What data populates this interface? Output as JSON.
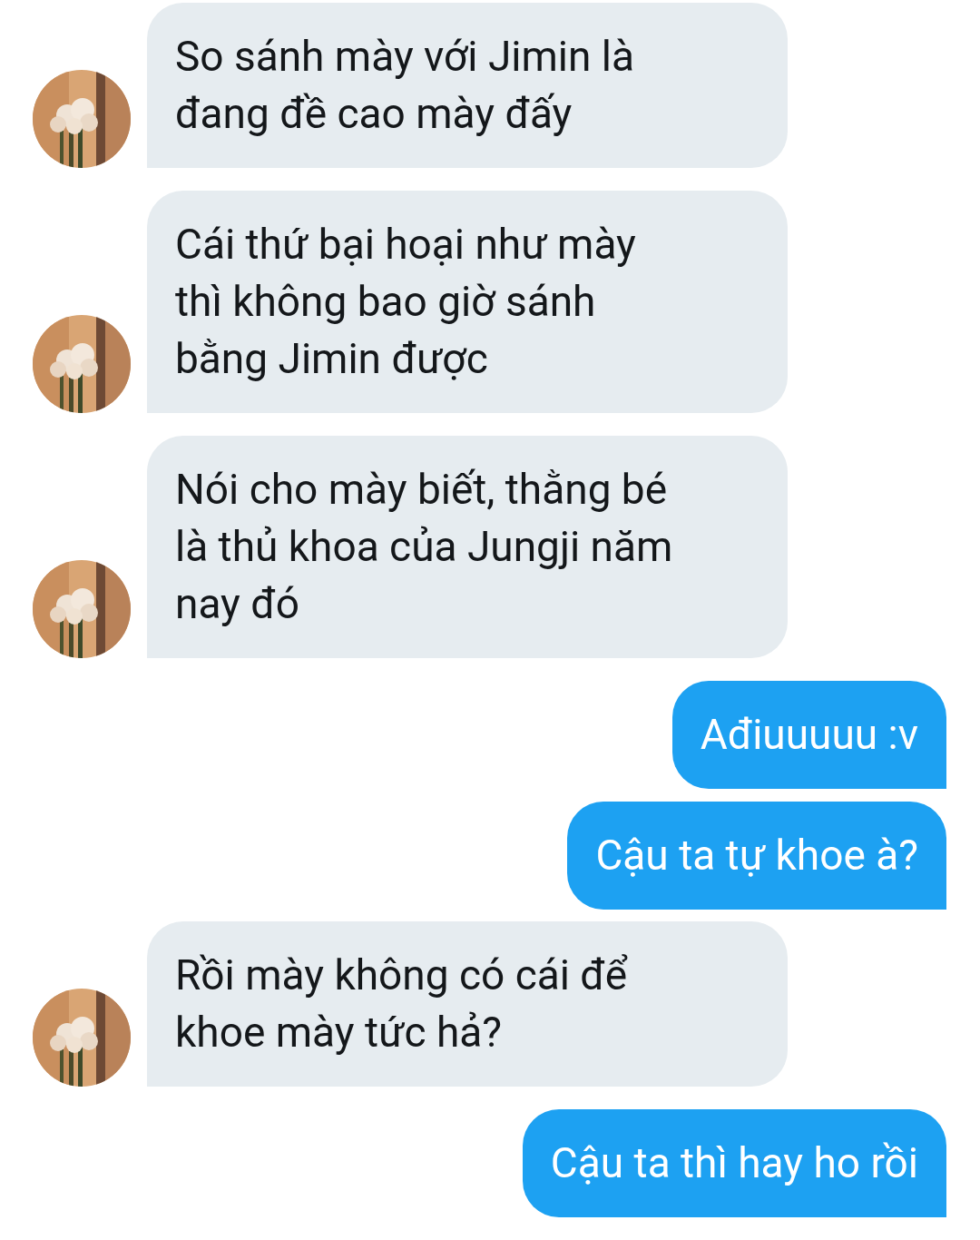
{
  "messages": [
    {
      "kind": "incoming",
      "text": "So sánh mày với Jimin là\nđang đề cao mày đấy"
    },
    {
      "kind": "incoming",
      "text": "Cái thứ bại hoại như mày\nthì không bao giờ sánh\nbằng Jimin được"
    },
    {
      "kind": "incoming",
      "text": "Nói cho mày biết, thằng bé\nlà thủ khoa của Jungji năm\nnay đó"
    },
    {
      "kind": "outgoing",
      "text": "Ađiuuuuu :v"
    },
    {
      "kind": "outgoing",
      "text": "Cậu ta tự khoe à?"
    },
    {
      "kind": "incoming",
      "text": "Rồi mày không có cái để\nkhoe mày tức hả?"
    },
    {
      "kind": "outgoing",
      "text": "Cậu ta thì hay ho rồi"
    }
  ]
}
